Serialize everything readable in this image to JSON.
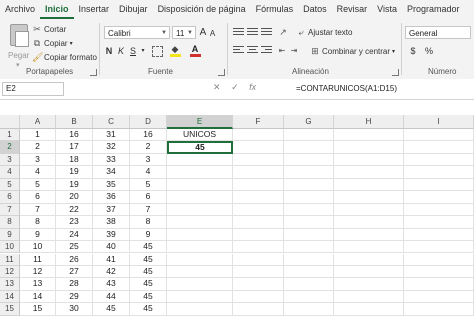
{
  "menu": [
    "Archivo",
    "Inicio",
    "Insertar",
    "Dibujar",
    "Disposición de página",
    "Fórmulas",
    "Datos",
    "Revisar",
    "Vista",
    "Programador"
  ],
  "clipboard": {
    "paste_label": "Pegar",
    "cut_label": "Cortar",
    "copy_label": "Copiar",
    "format_painter_label": "Copiar formato",
    "group_label": "Portapapeles"
  },
  "font": {
    "name": "Calibri",
    "size": "11",
    "grow_label": "A",
    "shrink_label": "A",
    "bold": "N",
    "italic": "K",
    "underline": "S",
    "group_label": "Fuente"
  },
  "alignment": {
    "wrap_label": "Ajustar texto",
    "merge_label": "Combinar y centrar",
    "group_label": "Alineación"
  },
  "number": {
    "format_value": "General",
    "currency": "$",
    "percent": "%",
    "group_label": "Número"
  },
  "formula_bar": {
    "name_box": "E2",
    "fx": "fx",
    "formula": "=CONTARUNICOS(A1:D15)"
  },
  "columns": [
    "A",
    "B",
    "C",
    "D",
    "E",
    "F",
    "G",
    "H",
    "I"
  ],
  "rows": [
    [
      "1",
      "16",
      "31",
      "16"
    ],
    [
      "2",
      "17",
      "32",
      "2"
    ],
    [
      "3",
      "18",
      "33",
      "3"
    ],
    [
      "4",
      "19",
      "34",
      "4"
    ],
    [
      "5",
      "19",
      "35",
      "5"
    ],
    [
      "6",
      "20",
      "36",
      "6"
    ],
    [
      "7",
      "22",
      "37",
      "7"
    ],
    [
      "8",
      "23",
      "38",
      "8"
    ],
    [
      "9",
      "24",
      "39",
      "9"
    ],
    [
      "10",
      "25",
      "40",
      "45"
    ],
    [
      "11",
      "26",
      "41",
      "45"
    ],
    [
      "12",
      "27",
      "42",
      "45"
    ],
    [
      "13",
      "28",
      "43",
      "45"
    ],
    [
      "14",
      "29",
      "44",
      "45"
    ],
    [
      "15",
      "30",
      "45",
      "45"
    ]
  ],
  "row_numbers": [
    "1",
    "2",
    "3",
    "4",
    "5",
    "6",
    "7",
    "8",
    "9",
    "10",
    "11",
    "12",
    "13",
    "14",
    "15"
  ],
  "extra": {
    "e1": "UNICOS",
    "e2": "45"
  },
  "colors": {
    "accent": "#1f6e3c",
    "fill_yellow": "#f5e31b",
    "font_red": "#d0312d"
  }
}
